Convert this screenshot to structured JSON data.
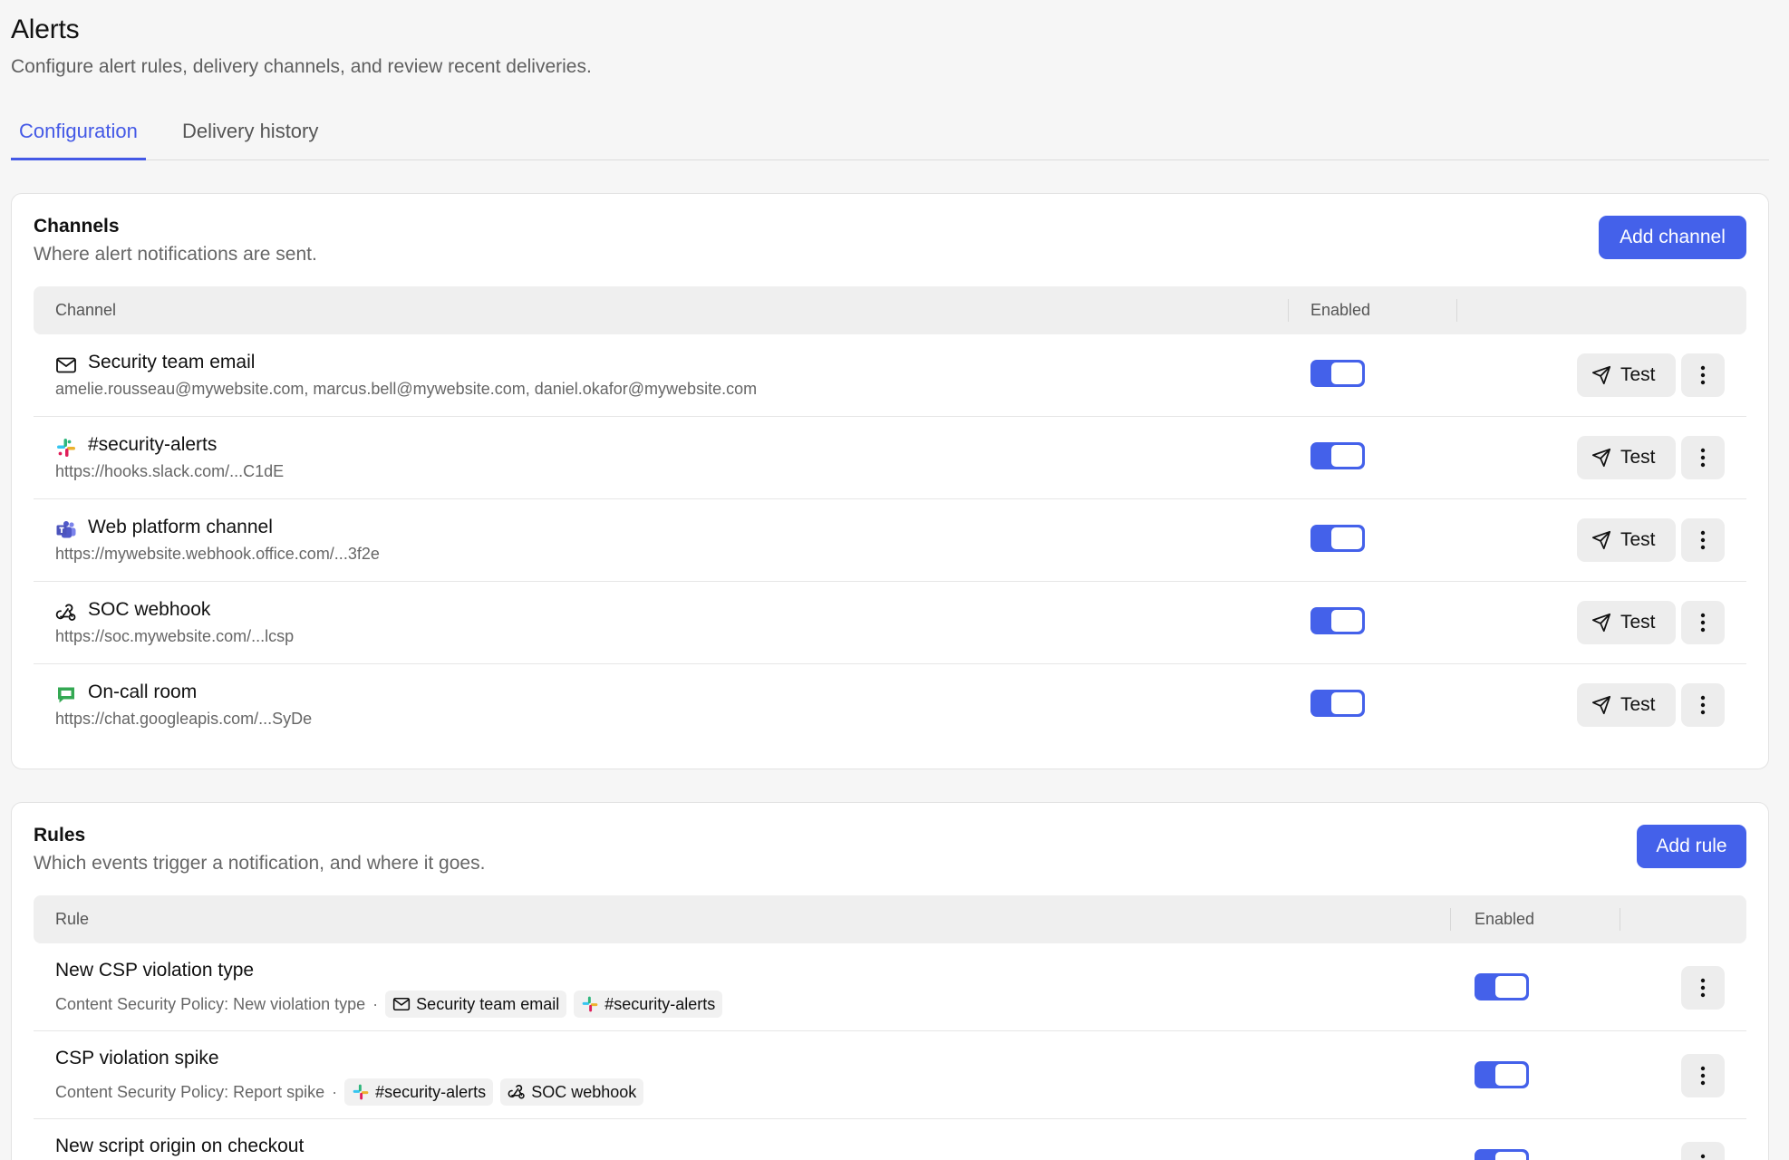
{
  "page": {
    "title": "Alerts",
    "subtitle": "Configure alert rules, delivery channels, and review recent deliveries."
  },
  "tabs": [
    {
      "label": "Configuration",
      "active": true
    },
    {
      "label": "Delivery history",
      "active": false
    }
  ],
  "colors": {
    "accent": "#4461ea",
    "slack": [
      "#36c5f0",
      "#2eb67d",
      "#ecb22e",
      "#e01e5a"
    ],
    "teams": "#5059c9",
    "gchat": "#34a853"
  },
  "channels": {
    "title": "Channels",
    "description": "Where alert notifications are sent.",
    "add_label": "Add channel",
    "columns": {
      "channel": "Channel",
      "enabled": "Enabled"
    },
    "test_label": "Test",
    "items": [
      {
        "icon": "mail-icon",
        "name": "Security team email",
        "detail": "amelie.rousseau@mywebsite.com, marcus.bell@mywebsite.com, daniel.okafor@mywebsite.com",
        "enabled": true
      },
      {
        "icon": "slack-icon",
        "name": "#security-alerts",
        "detail": "https://hooks.slack.com/...C1dE",
        "enabled": true
      },
      {
        "icon": "teams-icon",
        "name": "Web platform channel",
        "detail": "https://mywebsite.webhook.office.com/...3f2e",
        "enabled": true
      },
      {
        "icon": "webhook-icon",
        "name": "SOC webhook",
        "detail": "https://soc.mywebsite.com/...lcsp",
        "enabled": true
      },
      {
        "icon": "google-chat-icon",
        "name": "On-call room",
        "detail": "https://chat.googleapis.com/...SyDe",
        "enabled": true
      }
    ]
  },
  "rules": {
    "title": "Rules",
    "description": "Which events trigger a notification, and where it goes.",
    "add_label": "Add rule",
    "columns": {
      "rule": "Rule",
      "enabled": "Enabled"
    },
    "separator": "·",
    "items": [
      {
        "name": "New CSP violation type",
        "trigger": "Content Security Policy: New violation type",
        "enabled": true,
        "channels": [
          {
            "icon": "mail-icon",
            "label": "Security team email"
          },
          {
            "icon": "slack-icon",
            "label": "#security-alerts"
          }
        ]
      },
      {
        "name": "CSP violation spike",
        "trigger": "Content Security Policy: Report spike",
        "enabled": true,
        "channels": [
          {
            "icon": "slack-icon",
            "label": "#security-alerts"
          },
          {
            "icon": "webhook-icon",
            "label": "SOC webhook"
          }
        ]
      },
      {
        "name": "New script origin on checkout",
        "trigger": "",
        "enabled": true,
        "channels": []
      }
    ]
  }
}
